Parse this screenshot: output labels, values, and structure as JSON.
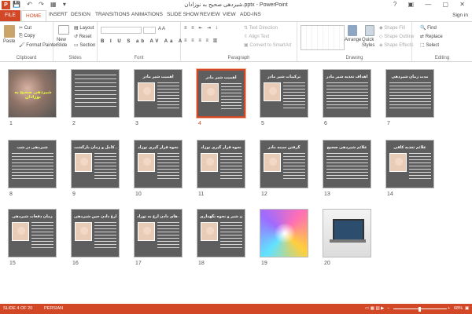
{
  "titlebar": {
    "app_icon": "P",
    "title": "شیردهی صحیح به نوزادان.pptx - PowerPoint",
    "qat_icons": "💾 ↶ ↷ ▦ ▾",
    "window_buttons": "? ▣ — ▢ ✕"
  },
  "tabs": [
    {
      "label": "FILE"
    },
    {
      "label": "HOME"
    },
    {
      "label": "INSERT"
    },
    {
      "label": "DESIGN"
    },
    {
      "label": "TRANSITIONS"
    },
    {
      "label": "ANIMATIONS"
    },
    {
      "label": "SLIDE SHOW"
    },
    {
      "label": "REVIEW"
    },
    {
      "label": "VIEW"
    },
    {
      "label": "ADD-INS"
    }
  ],
  "signin": "Sign in",
  "ribbon": {
    "clipboard": {
      "paste": "Paste",
      "cut": "Cut",
      "copy": "Copy",
      "format_painter": "Format Painter",
      "label": "Clipboard"
    },
    "slides": {
      "new_slide": "New Slide",
      "layout": "Layout",
      "reset": "Reset",
      "section": "Section",
      "label": "Slides"
    },
    "font": {
      "label": "Font"
    },
    "paragraph": {
      "text_direction": "Text Direction",
      "align_text": "Align Text",
      "convert": "Convert to SmartArt",
      "label": "Paragraph"
    },
    "drawing": {
      "arrange": "Arrange",
      "quick_styles": "Quick Styles",
      "shape_fill": "Shape Fill",
      "shape_outline": "Shape Outline",
      "shape_effects": "Shape Effects",
      "label": "Drawing"
    },
    "editing": {
      "find": "Find",
      "replace": "Replace",
      "select": "Select",
      "label": "Editing"
    }
  },
  "slides": [
    {
      "num": "1",
      "kind": "cover",
      "title": "",
      "text": "شیردهی صحیح به نوزادان"
    },
    {
      "num": "2",
      "kind": "calli",
      "title": "",
      "text": ""
    },
    {
      "num": "3",
      "kind": "content",
      "title": "اهمیت شیر مادر",
      "text": ""
    },
    {
      "num": "4",
      "kind": "content",
      "title": "اهمیت شیر مادر",
      "text": ""
    },
    {
      "num": "5",
      "kind": "content",
      "title": "ترکیبات شیر مادر",
      "text": ""
    },
    {
      "num": "6",
      "kind": "text",
      "title": "اهداف تغذیه شیر مادر",
      "text": ""
    },
    {
      "num": "7",
      "kind": "text",
      "title": "مدت زمان شیردهی",
      "text": ""
    },
    {
      "num": "8",
      "kind": "text",
      "title": "شیردهی در شب",
      "text": ""
    },
    {
      "num": "9",
      "kind": "content",
      "title": "موارد منع شیردهی کامل و زمان بازگشت",
      "text": ""
    },
    {
      "num": "10",
      "kind": "content",
      "title": "نحوه قرار گیری نوزاد",
      "text": ""
    },
    {
      "num": "11",
      "kind": "content",
      "title": "نحوه قرار گیری نوزاد",
      "text": ""
    },
    {
      "num": "12",
      "kind": "content",
      "title": "گرفتن سینه مادر",
      "text": ""
    },
    {
      "num": "13",
      "kind": "text",
      "title": "علائم شیردهی صحیح",
      "text": ""
    },
    {
      "num": "14",
      "kind": "content",
      "title": "علائم تغذیه کافی",
      "text": ""
    },
    {
      "num": "15",
      "kind": "content",
      "title": "زمان دفعات شیردهی",
      "text": ""
    },
    {
      "num": "16",
      "kind": "content",
      "title": "آرغ دادن حین شیردهی",
      "text": ""
    },
    {
      "num": "17",
      "kind": "content",
      "title": "تکنیک های دادن آرغ به نوزاد",
      "text": ""
    },
    {
      "num": "18",
      "kind": "content",
      "title": "دوشیدن شیر و نحوه نگهداری",
      "text": ""
    },
    {
      "num": "19",
      "kind": "swirl",
      "title": "",
      "text": ""
    },
    {
      "num": "20",
      "kind": "laptop",
      "title": "",
      "text": ""
    }
  ],
  "selected_slide": "4",
  "status": {
    "slide_info": "SLIDE 4 OF 20",
    "language": "PERSIAN",
    "zoom": "68%"
  },
  "colors": {
    "accent": "#d24726",
    "slide_bg": "#5e5e5e"
  }
}
